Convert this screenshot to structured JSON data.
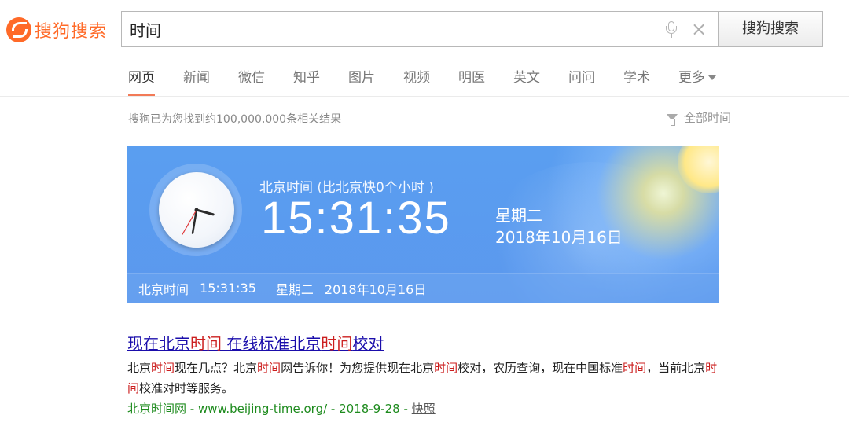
{
  "header": {
    "logo_text": "搜狗搜索",
    "search_value": "时间",
    "search_button": "搜狗搜索",
    "clear_symbol": "×"
  },
  "tabs": [
    {
      "label": "网页",
      "active": true
    },
    {
      "label": "新闻"
    },
    {
      "label": "微信"
    },
    {
      "label": "知乎"
    },
    {
      "label": "图片"
    },
    {
      "label": "视频"
    },
    {
      "label": "明医"
    },
    {
      "label": "英文"
    },
    {
      "label": "问问"
    },
    {
      "label": "学术"
    },
    {
      "label": "更多"
    }
  ],
  "results_info": {
    "count_text": "搜狗已为您找到约100,000,000条相关结果",
    "time_filter": "全部时间"
  },
  "clock_card": {
    "city_label": "北京时间 (比北京快0个小时 )",
    "time": "15:31:35",
    "weekday": "星期二",
    "date": "2018年10月16日",
    "footer": {
      "label": "北京时间",
      "time": "15:31:35",
      "weekday": "星期二",
      "date": "2018年10月16日"
    },
    "hands": {
      "hour": 15,
      "minute": 31,
      "second": 35
    }
  },
  "result": {
    "title_parts": [
      "现在北京",
      "时间",
      " 在线标准北京",
      "时间",
      "校对"
    ],
    "snippet_parts": [
      "北京",
      "时间",
      "现在几点？北京",
      "时间",
      "网告诉你！为您提供现在北京",
      "时间",
      "校对，农历查询，现在中国标准",
      "时间",
      "，当前北京",
      "时间",
      "校准对时等服务。"
    ],
    "url_text": "北京时间网 - www.beijing-time.org/ - 2018-9-28 - ",
    "cache_label": "快照"
  },
  "colors": {
    "brand": "#ff6a28",
    "card_blue": "#5a9ef0",
    "link": "#1a0dab",
    "highlight": "#cc1f1f",
    "url_green": "#1e8b1e",
    "active_tab_underline": "#f27a57"
  }
}
